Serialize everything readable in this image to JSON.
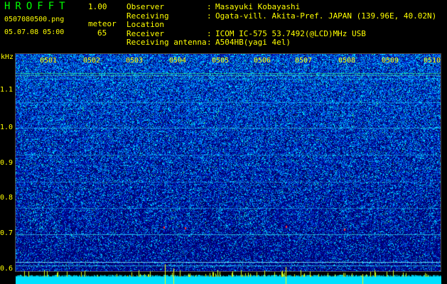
{
  "header": {
    "title": "HROFFT",
    "version": "1.00",
    "filename": "0507080500.png",
    "timestamp": "05.07.08 05:00",
    "meteor_label": "meteor",
    "meteor_count": "65"
  },
  "info": {
    "rows": [
      {
        "key": "Observer",
        "value": "Masayuki Kobayashi"
      },
      {
        "key": "Receiving Location",
        "value": "Ogata-vill. Akita-Pref. JAPAN (139.96E, 40.02N)"
      },
      {
        "key": "Receiver",
        "value": "ICOM IC-575 53.7492(@LCD)MHz USB"
      },
      {
        "key": "Receiving antenna",
        "value": "A504HB(yagi 4el)"
      }
    ]
  },
  "spectrogram": {
    "unit_label": "kHz",
    "y_ticks": [
      "1.1",
      "1.0",
      "0.9",
      "0.8",
      "0.7",
      "0.6"
    ],
    "x_ticks": [
      "0501",
      "0502",
      "0503",
      "0504",
      "0505",
      "0506",
      "0507",
      "0508",
      "0509",
      "0510"
    ],
    "colors": {
      "background": "#000000",
      "low": "#0000a0",
      "mid": "#0060ff",
      "high": "#00d8ff",
      "peak": "#ffff00",
      "labels": "#ffff00",
      "title": "#00ff00"
    }
  }
}
